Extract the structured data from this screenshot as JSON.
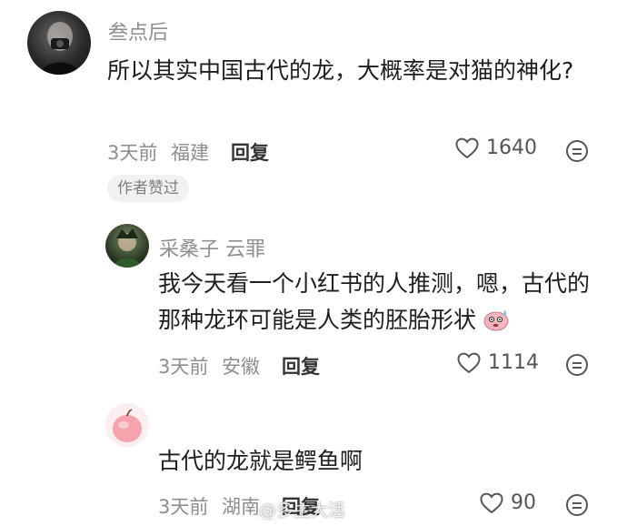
{
  "thread": {
    "comment": {
      "username": "叁点后",
      "text": "所以其实中国古代的龙，大概率是对猫的神化?",
      "time": "3天前",
      "location": "福建",
      "reply_label": "回复",
      "likes": "1640",
      "badge": "作者赞过"
    },
    "replies": [
      {
        "username": "采桑子 云罪",
        "text": "我今天看一个小红书的人推测，嗯，古代的那种龙环可能是人类的胚胎形状",
        "time": "3天前",
        "location": "安徽",
        "reply_label": "回复",
        "likes": "1114"
      },
      {
        "username": "",
        "text": "古代的龙就是鳄鱼啊",
        "time": "3天前",
        "location": "湖南",
        "reply_label": "回复",
        "likes": "90"
      }
    ]
  },
  "watermark": "@多主大活",
  "icons": {
    "like": "heart-outline-icon",
    "emoji": "emoji-face-icon"
  }
}
